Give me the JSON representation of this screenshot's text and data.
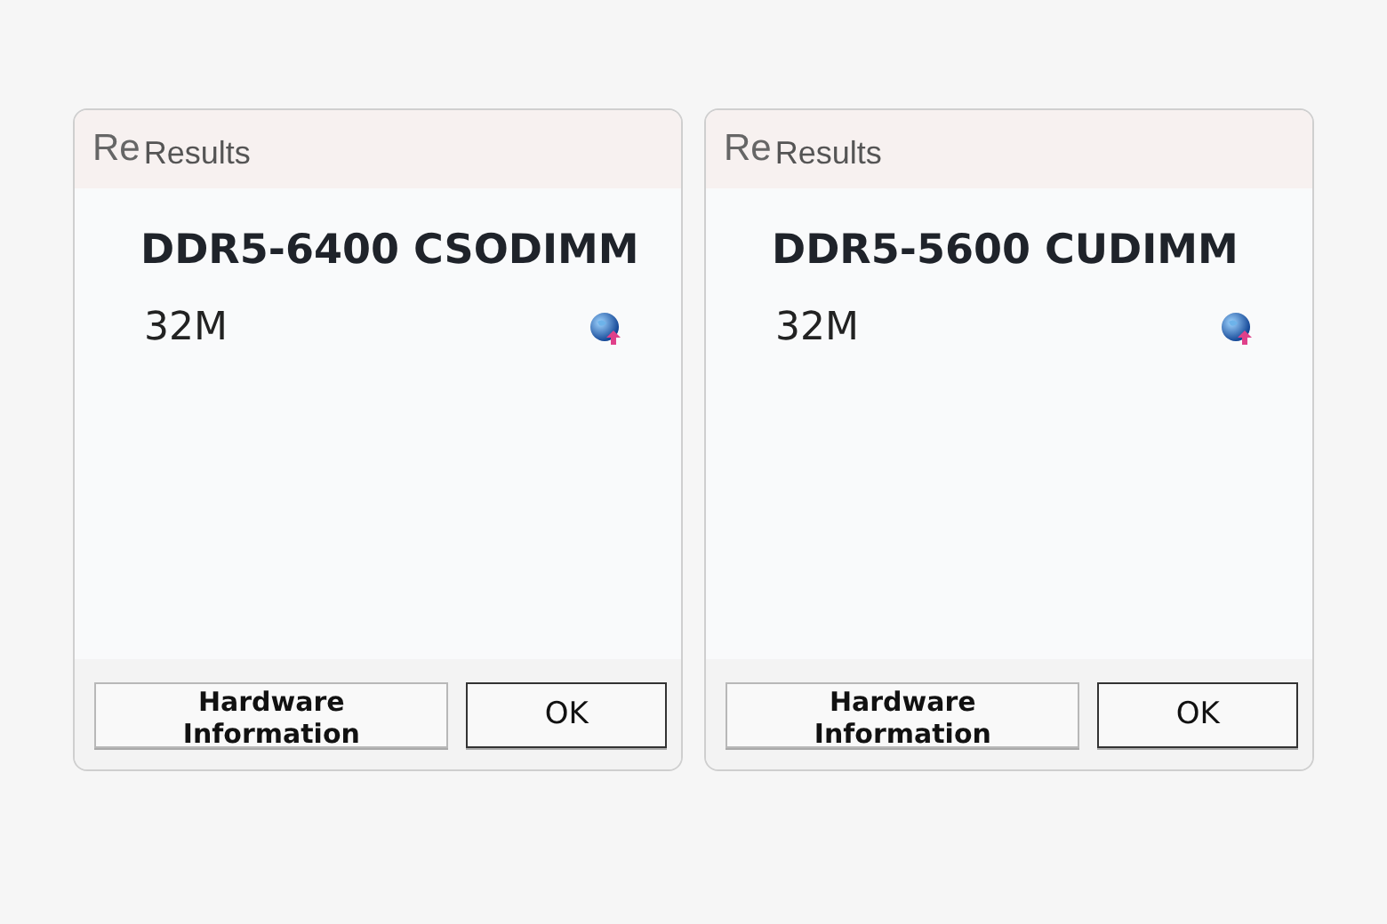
{
  "dialogs": [
    {
      "logo": "Re",
      "title": "Results",
      "heading": "DDR5-6400 CSODIMM",
      "value": "32M",
      "buttons": [
        {
          "label": "Hardware Information",
          "kind": "secondary"
        },
        {
          "label": "OK",
          "kind": "default"
        }
      ]
    },
    {
      "logo": "Re",
      "title": "Results",
      "heading": "DDR5-5600 CUDIMM",
      "value": "32M",
      "buttons": [
        {
          "label": "Hardware Information",
          "kind": "secondary"
        },
        {
          "label": "OK",
          "kind": "default"
        }
      ]
    }
  ]
}
